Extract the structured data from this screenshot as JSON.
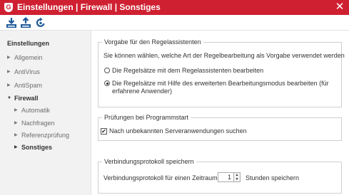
{
  "window": {
    "title": "Einstellungen | Firewall | Sonstiges",
    "logo_letter": "G",
    "close_glyph": "✕",
    "accent": "#cf2031"
  },
  "toolbar": {
    "buttons": [
      {
        "name": "import-icon"
      },
      {
        "name": "export-icon"
      },
      {
        "name": "reset-icon"
      }
    ]
  },
  "sidebar": {
    "header": "Einstellungen",
    "items": [
      {
        "label": "Allgemein",
        "arrow": "▶"
      },
      {
        "label": "AntiVirus",
        "arrow": "▶"
      },
      {
        "label": "AntiSpam",
        "arrow": "▶"
      },
      {
        "label": "Firewall",
        "arrow": "▼"
      }
    ],
    "sub_items": [
      {
        "label": "Automatik",
        "arrow": "▶"
      },
      {
        "label": "Nachfragen",
        "arrow": "▶"
      },
      {
        "label": "Referenzprüfung",
        "arrow": "▶"
      },
      {
        "label": "Sonstiges",
        "arrow": "▶"
      }
    ]
  },
  "groups": {
    "rules": {
      "legend": "Vorgabe für den Regelassistenten",
      "description": "Sie können wählen, welche Art der Regelbearbeitung als Vorgabe verwendet werden",
      "option1": "Die Regelsätze mit dem Regelassistenten bearbeiten",
      "option2_line1": "Die Regelsätze mit Hilfe des erweiterten Bearbeitungsmodus bearbeiten (für",
      "option2_line2": "erfahrene Anwender)",
      "selected": 2
    },
    "startup": {
      "legend": "Prüfungen bei Programmstart",
      "checkbox_label": "Nach unbekannten Serveranwendungen suchen",
      "checked": true,
      "check_glyph": "✔"
    },
    "log": {
      "legend": "Verbindungsprotokoll speichern",
      "label_before": "Verbindungsprotokoll für einen Zeitraum",
      "value": "1",
      "label_after": "Stunden speichern",
      "up_glyph": "▲",
      "down_glyph": "▼"
    }
  }
}
